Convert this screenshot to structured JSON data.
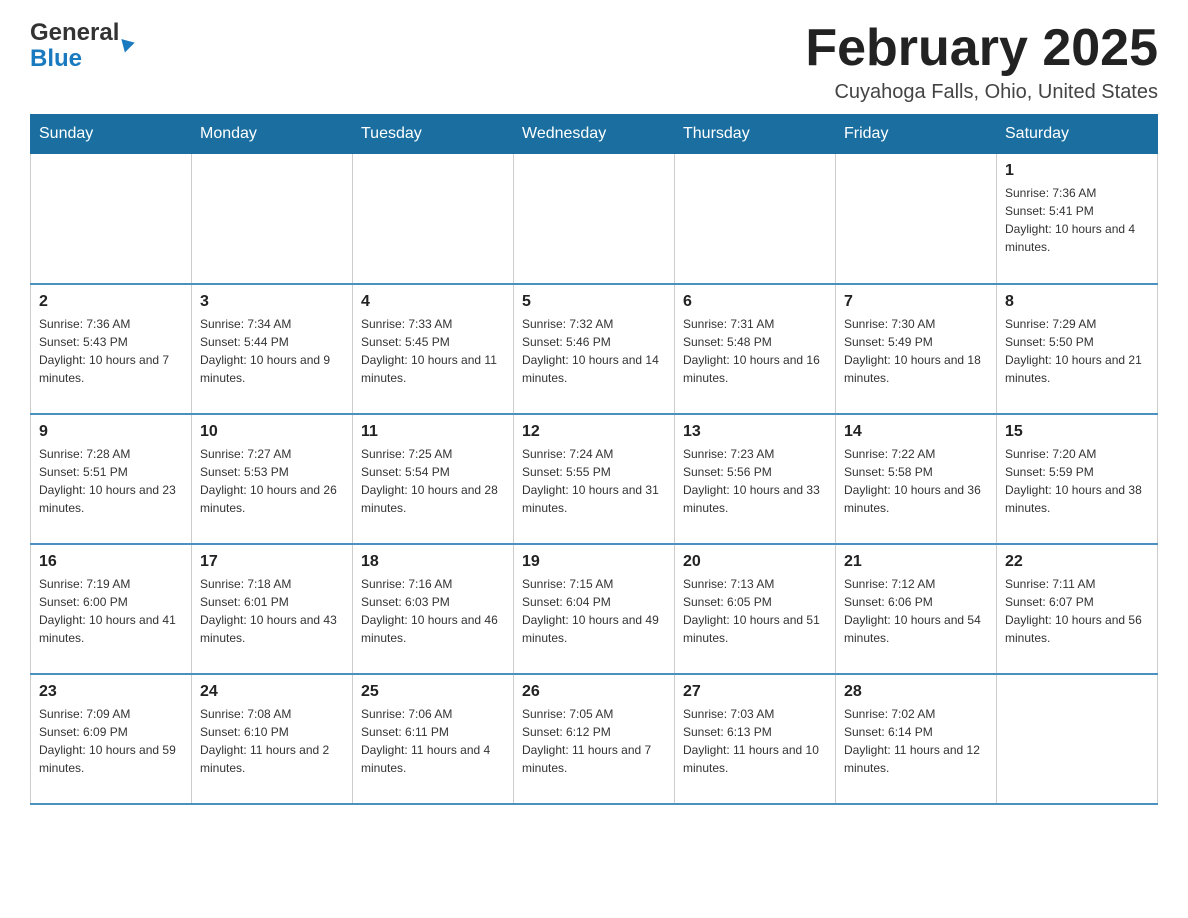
{
  "header": {
    "logo_general": "General",
    "logo_blue": "Blue",
    "month_title": "February 2025",
    "location": "Cuyahoga Falls, Ohio, United States"
  },
  "weekdays": [
    "Sunday",
    "Monday",
    "Tuesday",
    "Wednesday",
    "Thursday",
    "Friday",
    "Saturday"
  ],
  "weeks": [
    [
      {
        "day": "",
        "sunrise": "",
        "sunset": "",
        "daylight": ""
      },
      {
        "day": "",
        "sunrise": "",
        "sunset": "",
        "daylight": ""
      },
      {
        "day": "",
        "sunrise": "",
        "sunset": "",
        "daylight": ""
      },
      {
        "day": "",
        "sunrise": "",
        "sunset": "",
        "daylight": ""
      },
      {
        "day": "",
        "sunrise": "",
        "sunset": "",
        "daylight": ""
      },
      {
        "day": "",
        "sunrise": "",
        "sunset": "",
        "daylight": ""
      },
      {
        "day": "1",
        "sunrise": "Sunrise: 7:36 AM",
        "sunset": "Sunset: 5:41 PM",
        "daylight": "Daylight: 10 hours and 4 minutes."
      }
    ],
    [
      {
        "day": "2",
        "sunrise": "Sunrise: 7:36 AM",
        "sunset": "Sunset: 5:43 PM",
        "daylight": "Daylight: 10 hours and 7 minutes."
      },
      {
        "day": "3",
        "sunrise": "Sunrise: 7:34 AM",
        "sunset": "Sunset: 5:44 PM",
        "daylight": "Daylight: 10 hours and 9 minutes."
      },
      {
        "day": "4",
        "sunrise": "Sunrise: 7:33 AM",
        "sunset": "Sunset: 5:45 PM",
        "daylight": "Daylight: 10 hours and 11 minutes."
      },
      {
        "day": "5",
        "sunrise": "Sunrise: 7:32 AM",
        "sunset": "Sunset: 5:46 PM",
        "daylight": "Daylight: 10 hours and 14 minutes."
      },
      {
        "day": "6",
        "sunrise": "Sunrise: 7:31 AM",
        "sunset": "Sunset: 5:48 PM",
        "daylight": "Daylight: 10 hours and 16 minutes."
      },
      {
        "day": "7",
        "sunrise": "Sunrise: 7:30 AM",
        "sunset": "Sunset: 5:49 PM",
        "daylight": "Daylight: 10 hours and 18 minutes."
      },
      {
        "day": "8",
        "sunrise": "Sunrise: 7:29 AM",
        "sunset": "Sunset: 5:50 PM",
        "daylight": "Daylight: 10 hours and 21 minutes."
      }
    ],
    [
      {
        "day": "9",
        "sunrise": "Sunrise: 7:28 AM",
        "sunset": "Sunset: 5:51 PM",
        "daylight": "Daylight: 10 hours and 23 minutes."
      },
      {
        "day": "10",
        "sunrise": "Sunrise: 7:27 AM",
        "sunset": "Sunset: 5:53 PM",
        "daylight": "Daylight: 10 hours and 26 minutes."
      },
      {
        "day": "11",
        "sunrise": "Sunrise: 7:25 AM",
        "sunset": "Sunset: 5:54 PM",
        "daylight": "Daylight: 10 hours and 28 minutes."
      },
      {
        "day": "12",
        "sunrise": "Sunrise: 7:24 AM",
        "sunset": "Sunset: 5:55 PM",
        "daylight": "Daylight: 10 hours and 31 minutes."
      },
      {
        "day": "13",
        "sunrise": "Sunrise: 7:23 AM",
        "sunset": "Sunset: 5:56 PM",
        "daylight": "Daylight: 10 hours and 33 minutes."
      },
      {
        "day": "14",
        "sunrise": "Sunrise: 7:22 AM",
        "sunset": "Sunset: 5:58 PM",
        "daylight": "Daylight: 10 hours and 36 minutes."
      },
      {
        "day": "15",
        "sunrise": "Sunrise: 7:20 AM",
        "sunset": "Sunset: 5:59 PM",
        "daylight": "Daylight: 10 hours and 38 minutes."
      }
    ],
    [
      {
        "day": "16",
        "sunrise": "Sunrise: 7:19 AM",
        "sunset": "Sunset: 6:00 PM",
        "daylight": "Daylight: 10 hours and 41 minutes."
      },
      {
        "day": "17",
        "sunrise": "Sunrise: 7:18 AM",
        "sunset": "Sunset: 6:01 PM",
        "daylight": "Daylight: 10 hours and 43 minutes."
      },
      {
        "day": "18",
        "sunrise": "Sunrise: 7:16 AM",
        "sunset": "Sunset: 6:03 PM",
        "daylight": "Daylight: 10 hours and 46 minutes."
      },
      {
        "day": "19",
        "sunrise": "Sunrise: 7:15 AM",
        "sunset": "Sunset: 6:04 PM",
        "daylight": "Daylight: 10 hours and 49 minutes."
      },
      {
        "day": "20",
        "sunrise": "Sunrise: 7:13 AM",
        "sunset": "Sunset: 6:05 PM",
        "daylight": "Daylight: 10 hours and 51 minutes."
      },
      {
        "day": "21",
        "sunrise": "Sunrise: 7:12 AM",
        "sunset": "Sunset: 6:06 PM",
        "daylight": "Daylight: 10 hours and 54 minutes."
      },
      {
        "day": "22",
        "sunrise": "Sunrise: 7:11 AM",
        "sunset": "Sunset: 6:07 PM",
        "daylight": "Daylight: 10 hours and 56 minutes."
      }
    ],
    [
      {
        "day": "23",
        "sunrise": "Sunrise: 7:09 AM",
        "sunset": "Sunset: 6:09 PM",
        "daylight": "Daylight: 10 hours and 59 minutes."
      },
      {
        "day": "24",
        "sunrise": "Sunrise: 7:08 AM",
        "sunset": "Sunset: 6:10 PM",
        "daylight": "Daylight: 11 hours and 2 minutes."
      },
      {
        "day": "25",
        "sunrise": "Sunrise: 7:06 AM",
        "sunset": "Sunset: 6:11 PM",
        "daylight": "Daylight: 11 hours and 4 minutes."
      },
      {
        "day": "26",
        "sunrise": "Sunrise: 7:05 AM",
        "sunset": "Sunset: 6:12 PM",
        "daylight": "Daylight: 11 hours and 7 minutes."
      },
      {
        "day": "27",
        "sunrise": "Sunrise: 7:03 AM",
        "sunset": "Sunset: 6:13 PM",
        "daylight": "Daylight: 11 hours and 10 minutes."
      },
      {
        "day": "28",
        "sunrise": "Sunrise: 7:02 AM",
        "sunset": "Sunset: 6:14 PM",
        "daylight": "Daylight: 11 hours and 12 minutes."
      },
      {
        "day": "",
        "sunrise": "",
        "sunset": "",
        "daylight": ""
      }
    ]
  ]
}
